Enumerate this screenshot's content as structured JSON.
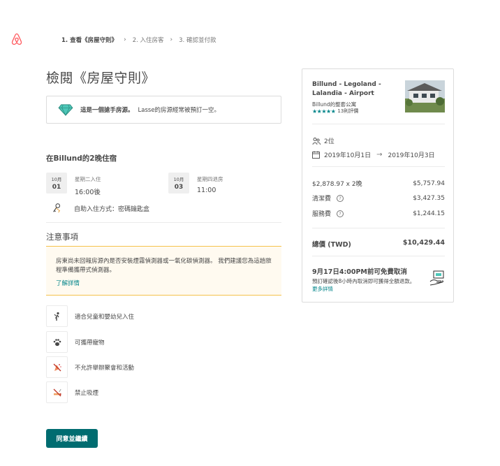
{
  "steps": [
    {
      "label": "1. 查看《房屋守則》",
      "active": true
    },
    {
      "label": "2. 入住房客",
      "active": false
    },
    {
      "label": "3. 確認並付款",
      "active": false
    }
  ],
  "step_separator": "›",
  "page_title": "檢閱《房屋守則》",
  "rare_find": {
    "strong": "這是一個搶手房源。",
    "text": "Lasse的房源經常被預訂一空。"
  },
  "stay": {
    "title": "在Billund的2晚住宿",
    "checkin": {
      "month": "10月",
      "day": "01",
      "label": "星期二入住",
      "time": "16:00後"
    },
    "checkout": {
      "month": "10月",
      "day": "03",
      "label": "星期四退房",
      "time": "11:00"
    },
    "self_checkin": "自助入住方式：密碼鑰匙盒"
  },
  "notes": {
    "title": "注意事項",
    "notice_text": "房東尚未回報房源內是否安裝煙霧偵測器或一氧化碳偵測器。 我們建議您為這趟旅程準備攜帶式偵測器。",
    "learn_more": "了解詳情"
  },
  "rules": [
    {
      "icon": "child-icon",
      "text": "適合兒童和嬰幼兒入住"
    },
    {
      "icon": "paw-icon",
      "text": "可攜帶寵物"
    },
    {
      "icon": "no-party-icon",
      "text": "不允許舉辦聚會和活動"
    },
    {
      "icon": "no-smoking-icon",
      "text": "禁止吸煙"
    }
  ],
  "agree_button": "同意並繼續",
  "card": {
    "listing_title": "Billund - Legoland - Lalandia - Airport",
    "listing_type": "Billund的整套公寓",
    "stars": "★★★★★",
    "rating": 4.5,
    "reviews": "13則評價",
    "guests": "2位",
    "check_in_date": "2019年10月1日",
    "check_out_date": "2019年10月3日",
    "date_arrow": "→",
    "nightly_label": "$2,878.97 x 2晚",
    "nightly_total": "$5,757.94",
    "cleaning_label": "清潔費",
    "cleaning_fee": "$3,427.35",
    "service_label": "服務費",
    "service_fee": "$1,244.15",
    "total_label": "總價 (TWD)",
    "total": "$10,429.44",
    "cancel_title": "9月17日4:00PM前可免費取消",
    "cancel_text": "預訂確認後8小時內取消即可獲得全額退款。",
    "cancel_more": "更多詳情"
  },
  "colors": {
    "brand": "#ff5a5f",
    "teal": "#008489",
    "button": "#006c70",
    "notice_border": "#f5c24a",
    "notice_bg": "#fffaf0"
  }
}
